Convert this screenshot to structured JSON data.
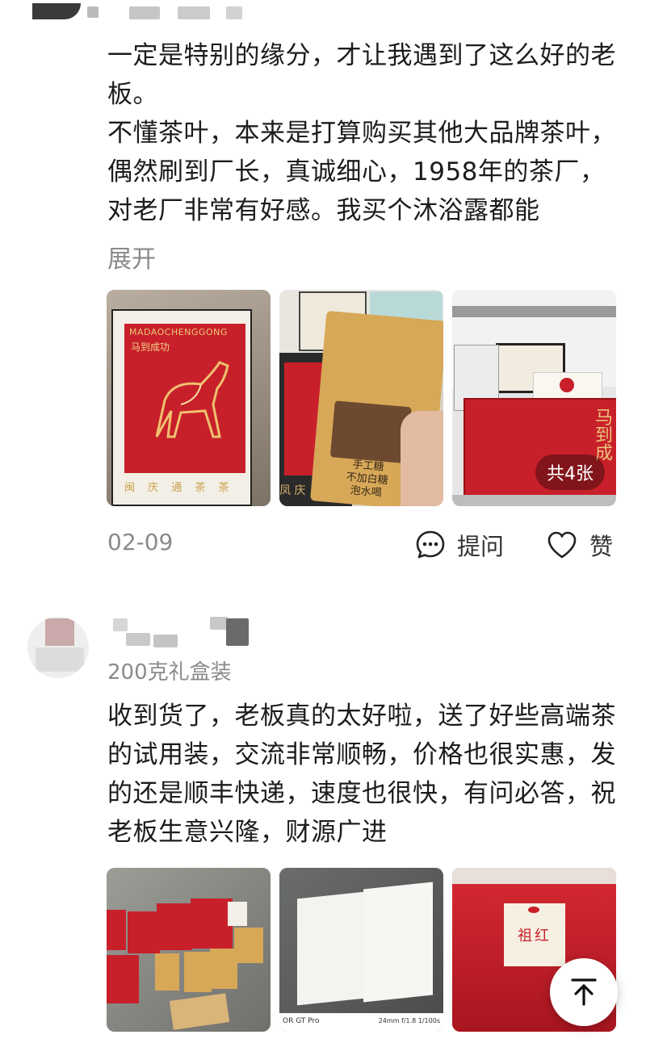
{
  "review1": {
    "paragraphs": [
      "一定是特别的缘分，才让我遇到了这么好的老板。",
      "不懂茶叶，本来是打算购买其他大品牌茶叶，偶然刷到厂长，真诚细心，1958年的茶厂，对老厂非常有好感。我买个沐浴露都能"
    ],
    "expand_label": "展开",
    "images": [
      {
        "box_title": "MADAOCHENGGONG",
        "box_cn": "马到成功",
        "bottom_text": "闽 庆 通 茶 茶"
      },
      {
        "bag_text": [
          "手工糖",
          "不加白糖",
          "泡水喝"
        ],
        "box_side": "凤 庆"
      },
      {
        "box_label": "马到成",
        "image_count_label": "共4张"
      }
    ],
    "date": "02-09",
    "ask_label": "提问",
    "like_label": "赞"
  },
  "review2": {
    "subtitle": "200克礼盒装",
    "paragraphs": [
      "收到货了，老板真的太好啦，送了好些高端茶的试用装，交流非常顺畅，价格也很实惠，发的还是顺丰快递，速度也很快，有问必答，祝老板生意兴隆，财源广进"
    ],
    "images": [
      {},
      {
        "camera_left": "OR GT Pro",
        "camera_right": "24mm f/1.8 1/100s"
      },
      {
        "label": "祖红"
      }
    ]
  },
  "colors": {
    "gift_red": "#c8202a",
    "kraft": "#d7a858",
    "muted_text": "#8a8a8a"
  },
  "icons": {
    "ask": "chat-bubble-icon",
    "like": "heart-icon",
    "top": "arrow-up-to-top-icon"
  }
}
